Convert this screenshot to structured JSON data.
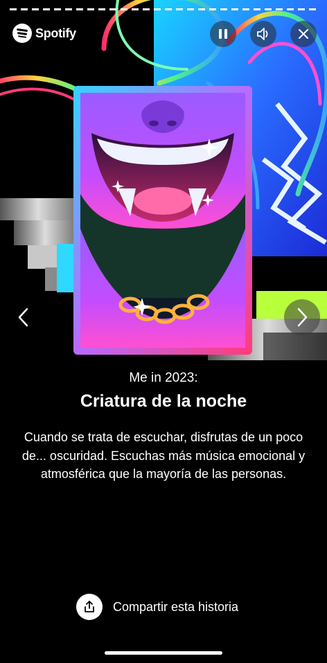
{
  "header": {
    "brand": "Spotify",
    "icons": [
      "spotify-logo-icon",
      "pause-icon",
      "volume-icon",
      "close-icon"
    ]
  },
  "story": {
    "subtitle": "Me in 2023:",
    "title": "Criatura de la noche",
    "description": "Cuando se trata de escuchar, disfrutas de un poco de... oscuridad. Escuchas más música emocional y atmosférica que la mayoría de las personas."
  },
  "share": {
    "label": "Compartir esta historia"
  },
  "colors": {
    "background": "#000000",
    "text": "#ffffff",
    "art_purple": "#8a4dff",
    "art_pink": "#e040c8",
    "art_blue": "#2a6cff",
    "art_green": "#b8ff3c"
  }
}
